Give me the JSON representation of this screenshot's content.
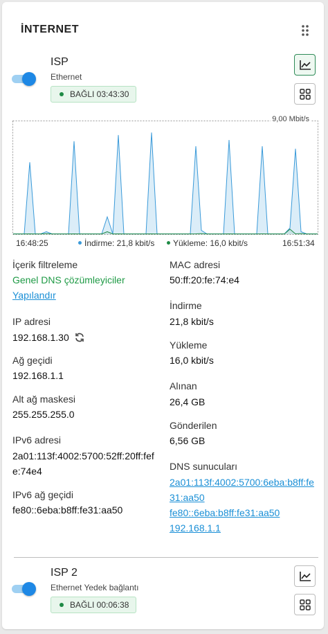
{
  "card": {
    "title": "İNTERNET"
  },
  "isp1": {
    "name": "ISP",
    "subtitle": "Ethernet",
    "status": "BAĞLI 03:43:30",
    "enabled": true
  },
  "chart": {
    "max_label": "9,00 Mbit/s",
    "start_time": "16:48:25",
    "end_time": "16:51:34",
    "legend_download": "İndirme: 21,8 kbit/s",
    "legend_upload": "Yükleme: 16,0 kbit/s",
    "download_color": "#3a9ad9",
    "upload_color": "#1e8a45"
  },
  "chart_data": {
    "type": "area",
    "ylim": [
      0,
      9.0
    ],
    "yunit": "Mbit/s",
    "x": [
      "16:48:25",
      "16:51:34"
    ],
    "series": [
      {
        "name": "İndirme",
        "values": [
          0.03,
          0.03,
          0.03,
          5.8,
          0.03,
          0.03,
          0.2,
          0.03,
          0.03,
          0.03,
          0.03,
          7.5,
          0.03,
          0.03,
          0.03,
          0.03,
          0.03,
          1.4,
          0.03,
          8.0,
          0.03,
          0.03,
          0.03,
          0.03,
          0.03,
          8.2,
          0.03,
          0.03,
          0.03,
          0.03,
          0.03,
          0.03,
          0.03,
          7.1,
          0.3,
          0.03,
          0.03,
          0.03,
          0.03,
          7.6,
          0.03,
          0.03,
          0.03,
          0.03,
          0.03,
          7.1,
          0.03,
          0.03,
          0.03,
          0.03,
          0.5,
          6.9,
          0.2,
          0.03,
          0.03,
          0.03
        ]
      },
      {
        "name": "Yükleme",
        "values": [
          0.02,
          0.02,
          0.02,
          0.03,
          0.02,
          0.02,
          0.05,
          0.02,
          0.02,
          0.02,
          0.02,
          0.03,
          0.02,
          0.02,
          0.02,
          0.02,
          0.02,
          0.2,
          0.02,
          0.03,
          0.02,
          0.02,
          0.02,
          0.02,
          0.02,
          0.03,
          0.02,
          0.02,
          0.02,
          0.02,
          0.02,
          0.02,
          0.02,
          0.03,
          0.05,
          0.02,
          0.02,
          0.02,
          0.02,
          0.03,
          0.02,
          0.02,
          0.02,
          0.02,
          0.02,
          0.03,
          0.02,
          0.02,
          0.02,
          0.02,
          0.4,
          0.03,
          0.05,
          0.02,
          0.02,
          0.02
        ]
      }
    ]
  },
  "details_left": [
    {
      "label": "İçerik filtreleme",
      "values": [
        "Genel DNS çözümleyiciler"
      ],
      "link": "Yapılandır"
    },
    {
      "label": "IP adresi",
      "values": [
        "192.168.1.30"
      ]
    },
    {
      "label": "Ağ geçidi",
      "values": [
        "192.168.1.1"
      ]
    },
    {
      "label": "Alt ağ maskesi",
      "values": [
        "255.255.255.0"
      ]
    },
    {
      "label": "IPv6 adresi",
      "values": [
        "2a01:113f:4002:5700:52ff:20ff:fef",
        "e:74e4"
      ]
    },
    {
      "label": "IPv6 ağ geçidi",
      "values": [
        "fe80::6eba:b8ff:fe31:aa50"
      ]
    }
  ],
  "details_right": [
    {
      "label": "MAC adresi",
      "values": [
        "50:ff:20:fe:74:e4"
      ]
    },
    {
      "label": "İndirme",
      "values": [
        "21,8 kbit/s"
      ]
    },
    {
      "label": "Yükleme",
      "values": [
        "16,0 kbit/s"
      ]
    },
    {
      "label": "Alınan",
      "values": [
        "26,4 GB"
      ]
    },
    {
      "label": "Gönderilen",
      "values": [
        "6,56 GB"
      ]
    },
    {
      "label": "DNS sunucuları",
      "links": [
        "2a01:113f:4002:5700:6eba:b8ff:fe",
        "31:aa50",
        "fe80::6eba:b8ff:fe31:aa50",
        "192.168.1.1"
      ]
    }
  ],
  "isp2": {
    "name": "ISP 2",
    "subtitle": "Ethernet Yedek bağlantı",
    "status": "BAĞLI 00:06:38",
    "enabled": true
  },
  "colors": {
    "accent": "#1e88e5",
    "status_green": "#1e8a45",
    "link": "#1a8fd6"
  }
}
